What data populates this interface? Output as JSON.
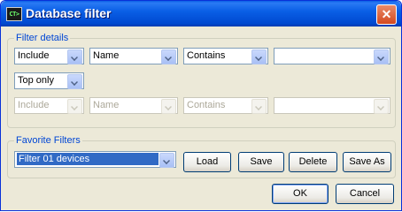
{
  "window": {
    "title": "Database filter",
    "app_icon_text": "CT>",
    "close_glyph": "✕"
  },
  "filter_details": {
    "legend": "Filter details",
    "row1": {
      "mode": "Include",
      "field": "Name",
      "operator": "Contains",
      "value": ""
    },
    "scope": "Top only",
    "row2": {
      "mode": "Include",
      "field": "Name",
      "operator": "Contains",
      "value": ""
    }
  },
  "favorite_filters": {
    "legend": "Favorite Filters",
    "selected": "Filter 01 devices",
    "buttons": {
      "load": "Load",
      "save": "Save",
      "delete": "Delete",
      "save_as": "Save As"
    }
  },
  "footer": {
    "ok": "OK",
    "cancel": "Cancel"
  }
}
